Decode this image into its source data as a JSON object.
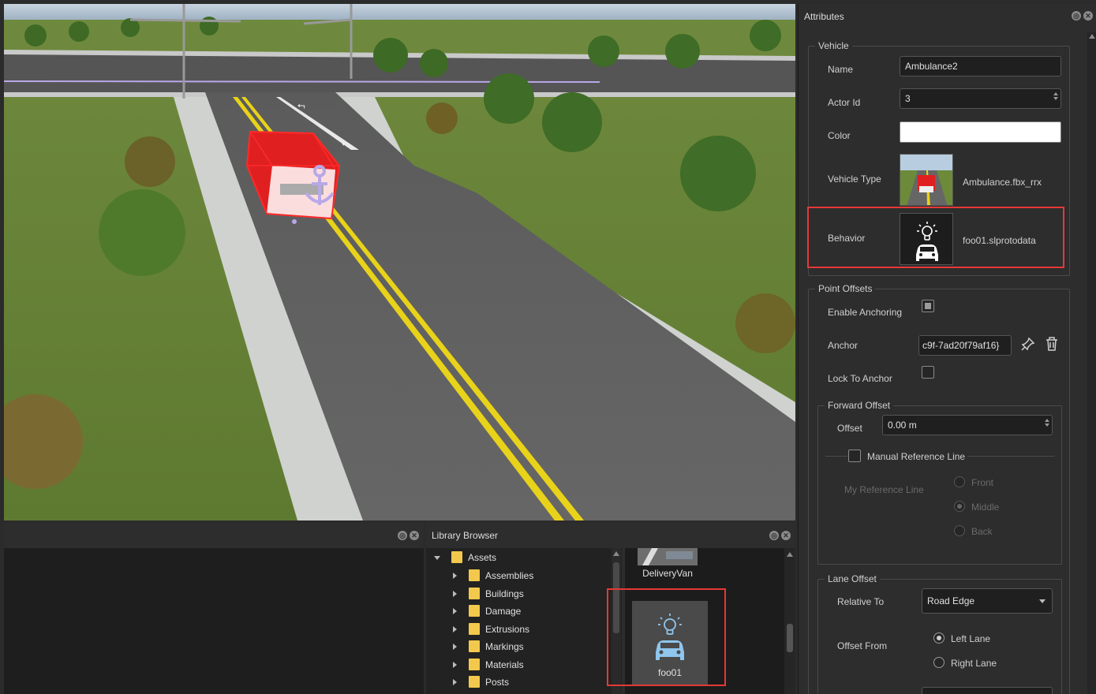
{
  "attributes": {
    "title": "Attributes",
    "vehicle": {
      "legend": "Vehicle",
      "name_label": "Name",
      "name_value": "Ambulance2",
      "actor_id_label": "Actor Id",
      "actor_id_value": "3",
      "color_label": "Color",
      "color_value": "#ffffff",
      "vehicle_type_label": "Vehicle Type",
      "vehicle_type_value": "Ambulance.fbx_rrx",
      "behavior_label": "Behavior",
      "behavior_value": "foo01.slprotodata"
    },
    "point_offsets": {
      "legend": "Point Offsets",
      "enable_anchoring_label": "Enable Anchoring",
      "enable_anchoring_checked": true,
      "anchor_label": "Anchor",
      "anchor_value": "c9f-7ad20f79af16}",
      "lock_to_anchor_label": "Lock To Anchor",
      "lock_to_anchor_checked": false,
      "forward_offset": {
        "legend": "Forward Offset",
        "offset_label": "Offset",
        "offset_value": "0.00 m",
        "manual_ref_label": "Manual Reference Line",
        "my_ref_label": "My Reference Line",
        "options": [
          "Front",
          "Middle",
          "Back"
        ],
        "selected": "Middle"
      },
      "lane_offset": {
        "legend": "Lane Offset",
        "relative_to_label": "Relative To",
        "relative_to_value": "Road Edge",
        "offset_from_label": "Offset From",
        "options": [
          "Left Lane",
          "Right Lane"
        ],
        "selected": "Left Lane"
      }
    }
  },
  "library": {
    "title": "Library Browser",
    "tree": {
      "root": "Assets",
      "children": [
        "Assemblies",
        "Buildings",
        "Damage",
        "Extrusions",
        "Markings",
        "Materials",
        "Posts"
      ]
    },
    "items": [
      {
        "label": "DeliveryVan",
        "icon": "delivery-van-thumbnail"
      },
      {
        "label": "foo01",
        "icon": "behavior-icon"
      }
    ]
  },
  "colors": {
    "highlight": "#e53935",
    "vehicle": "#e02020",
    "anchor": "#b9a8e8"
  }
}
